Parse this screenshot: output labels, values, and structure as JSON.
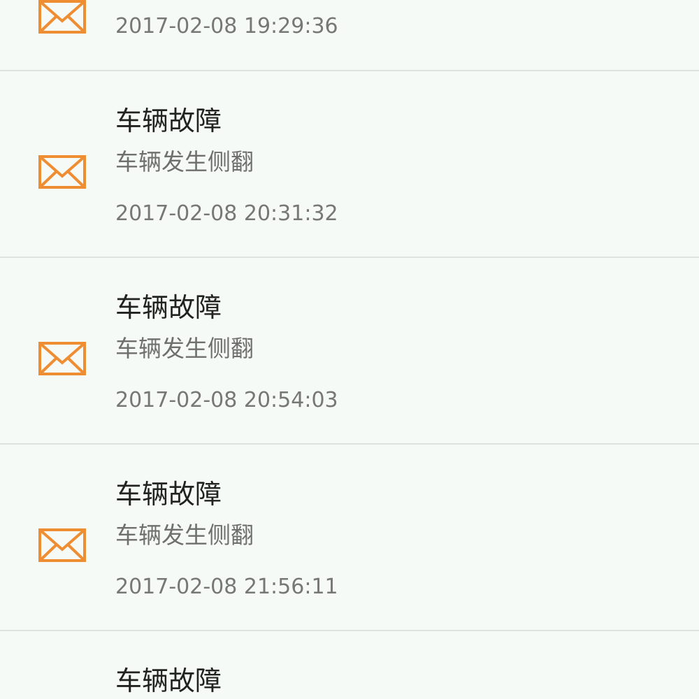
{
  "colors": {
    "background": "#f6faf6",
    "divider": "#dfe3df",
    "icon": "#ef8d32",
    "title": "#222222",
    "subtitle": "#6f6f6f",
    "time": "#777777"
  },
  "messages": [
    {
      "icon": "mail-icon",
      "title": "",
      "subtitle": "",
      "time": "2017-02-08 19:29:36"
    },
    {
      "icon": "mail-icon",
      "title": "车辆故障",
      "subtitle": "车辆发生侧翻",
      "time": "2017-02-08 20:31:32"
    },
    {
      "icon": "mail-icon",
      "title": "车辆故障",
      "subtitle": "车辆发生侧翻",
      "time": "2017-02-08 20:54:03"
    },
    {
      "icon": "mail-icon",
      "title": "车辆故障",
      "subtitle": "车辆发生侧翻",
      "time": "2017-02-08 21:56:11"
    },
    {
      "icon": "mail-icon",
      "title": "车辆故障",
      "subtitle": "",
      "time": ""
    }
  ]
}
